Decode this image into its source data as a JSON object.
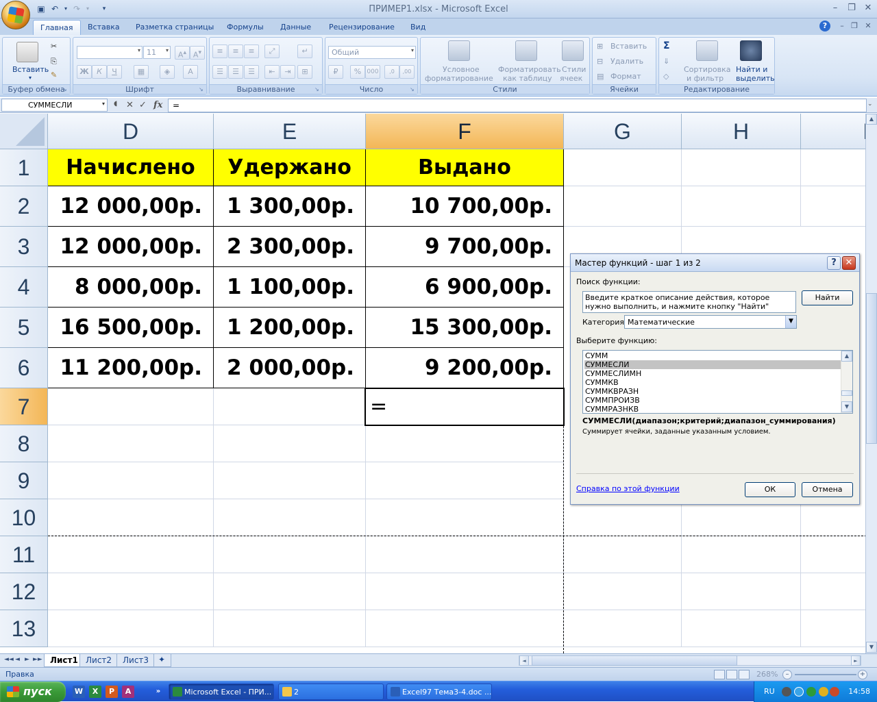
{
  "window": {
    "title": "ПРИМЕР1.xlsx - Microsoft Excel"
  },
  "ribbon": {
    "tabs": [
      {
        "label": "Главная",
        "active": true
      },
      {
        "label": "Вставка"
      },
      {
        "label": "Разметка страницы"
      },
      {
        "label": "Формулы"
      },
      {
        "label": "Данные"
      },
      {
        "label": "Рецензирование"
      },
      {
        "label": "Вид"
      }
    ],
    "groups": {
      "clipboard": {
        "label": "Буфер обмена",
        "paste": "Вставить"
      },
      "font": {
        "label": "Шрифт",
        "size": "11",
        "bold": "Ж",
        "italic": "К",
        "underline": "Ч"
      },
      "alignment": {
        "label": "Выравнивание"
      },
      "number": {
        "label": "Число",
        "format": "Общий"
      },
      "styles": {
        "label": "Стили",
        "conditional_1": "Условное",
        "conditional_2": "форматирование",
        "table_1": "Форматировать",
        "table_2": "как таблицу",
        "cells_1": "Стили",
        "cells_2": "ячеек"
      },
      "cells": {
        "label": "Ячейки",
        "insert": "Вставить",
        "delete": "Удалить",
        "format": "Формат"
      },
      "editing": {
        "label": "Редактирование",
        "sort_1": "Сортировка",
        "sort_2": "и фильтр",
        "find_1": "Найти и",
        "find_2": "выделить"
      }
    }
  },
  "formula_bar": {
    "name_box": "СУММЕСЛИ",
    "formula": "=",
    "fx": "fx"
  },
  "sheet": {
    "columns": [
      "D",
      "E",
      "F",
      "G",
      "H",
      "I"
    ],
    "rows": [
      "1",
      "2",
      "3",
      "4",
      "5",
      "6",
      "7",
      "8",
      "9",
      "10",
      "11",
      "12",
      "13"
    ],
    "header": [
      "Начислено",
      "Удержано",
      "Выдано"
    ],
    "data": [
      [
        "12 000,00р.",
        "1 300,00р.",
        "10 700,00р."
      ],
      [
        "12 000,00р.",
        "2 300,00р.",
        "9 700,00р."
      ],
      [
        "8 000,00р.",
        "1 100,00р.",
        "6 900,00р."
      ],
      [
        "16 500,00р.",
        "1 200,00р.",
        "15 300,00р."
      ],
      [
        "11 200,00р.",
        "2 000,00р.",
        "9 200,00р."
      ]
    ],
    "active_cell_value": "=",
    "tabs": [
      {
        "label": "Лист1",
        "active": true
      },
      {
        "label": "Лист2"
      },
      {
        "label": "Лист3"
      }
    ]
  },
  "status_bar": {
    "mode": "Правка",
    "zoom": "268%"
  },
  "dialog": {
    "title": "Мастер функций - шаг 1 из 2",
    "search_label": "Поиск функции:",
    "search_text": "Введите краткое описание действия, которое нужно выполнить, и нажмите кнопку \"Найти\"",
    "find_button": "Найти",
    "category_label": "Категория:",
    "category_value": "Математические",
    "select_label": "Выберите функцию:",
    "functions": [
      "СУММ",
      "СУММЕСЛИ",
      "СУММЕСЛИМН",
      "СУММКВ",
      "СУММКВРАЗН",
      "СУММПРОИЗВ",
      "СУММРАЗНКВ"
    ],
    "selected_index": 1,
    "signature": "СУММЕСЛИ(диапазон;критерий;диапазон_суммирования)",
    "description": "Суммирует ячейки, заданные указанным условием.",
    "help_link": "Справка по этой функции",
    "ok": "ОК",
    "cancel": "Отмена",
    "help_btn": "?",
    "close_btn": "✕"
  },
  "taskbar": {
    "start": "пуск",
    "tasks": [
      {
        "label": "Microsoft Excel - ПРИ...",
        "active": true
      },
      {
        "label": "2"
      },
      {
        "label": "Excel97 Тема3-4.doc ..."
      }
    ],
    "lang": "RU",
    "time": "14:58"
  },
  "colors": {
    "header_fill": "#ffff00",
    "selected_header": "#f3b656",
    "ribbon_bg": "#d8e5f5"
  }
}
